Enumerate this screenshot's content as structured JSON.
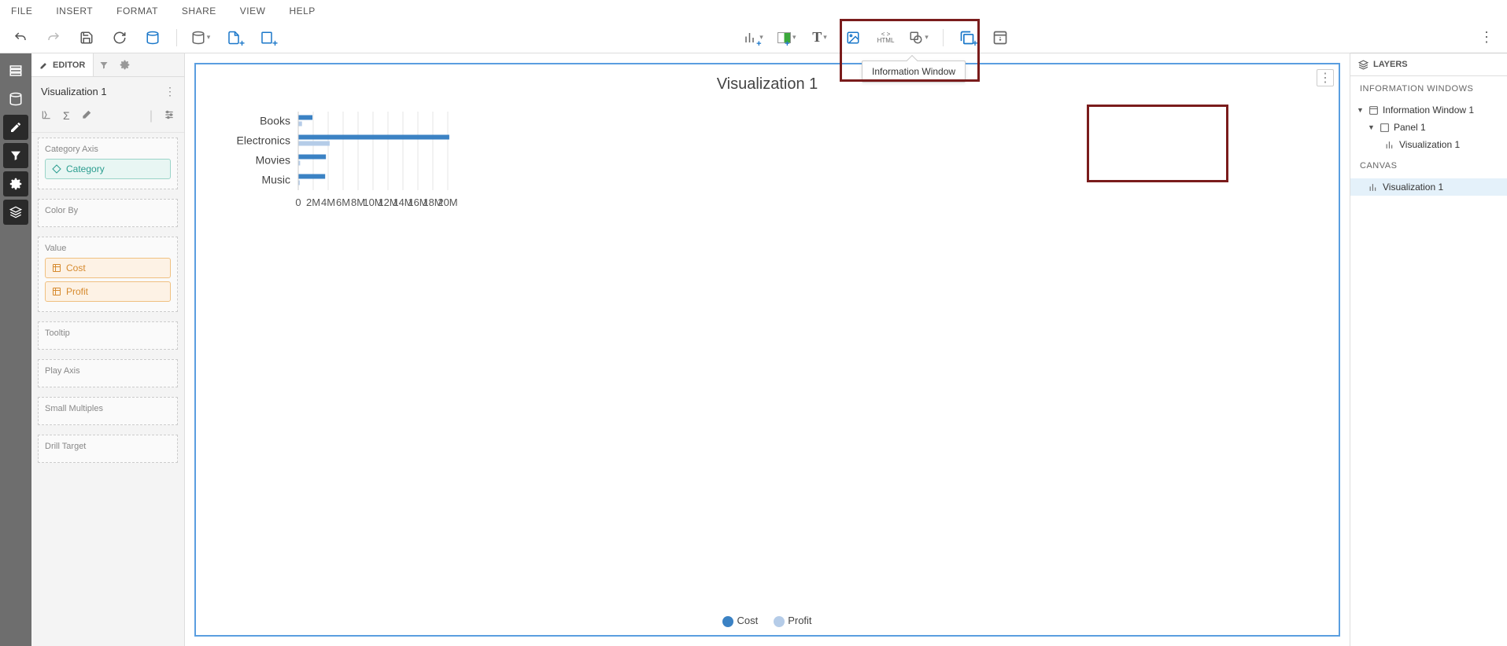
{
  "menu": {
    "items": [
      "FILE",
      "INSERT",
      "FORMAT",
      "SHARE",
      "VIEW",
      "HELP"
    ]
  },
  "tooltip": "Information Window",
  "editor": {
    "tab_label": "EDITOR",
    "viz_name": "Visualization 1",
    "sections": {
      "category_axis": "Category Axis",
      "color_by": "Color By",
      "value": "Value",
      "tooltip": "Tooltip",
      "play_axis": "Play Axis",
      "small_multiples": "Small Multiples",
      "drill_target": "Drill Target"
    },
    "pills": {
      "category": "Category",
      "cost": "Cost",
      "profit": "Profit"
    }
  },
  "chart_data": {
    "type": "bar",
    "orientation": "horizontal",
    "title": "Visualization 1",
    "categories": [
      "Books",
      "Electronics",
      "Movies",
      "Music"
    ],
    "series": [
      {
        "name": "Cost",
        "color": "#3b82c4",
        "values": [
          1900000,
          20200000,
          3700000,
          3600000
        ]
      },
      {
        "name": "Profit",
        "color": "#b5cce8",
        "values": [
          500000,
          4200000,
          250000,
          200000
        ]
      }
    ],
    "xlim": [
      0,
      20000000
    ],
    "xticks": [
      0,
      2000000,
      4000000,
      6000000,
      8000000,
      10000000,
      12000000,
      14000000,
      16000000,
      18000000,
      20000000
    ],
    "xtick_labels": [
      "0",
      "2M",
      "4M",
      "6M",
      "8M",
      "10M",
      "12M",
      "14M",
      "16M",
      "18M",
      "20M"
    ]
  },
  "layers": {
    "tab": "LAYERS",
    "section_info": "INFORMATION WINDOWS",
    "section_canvas": "CANVAS",
    "info_window": "Information Window 1",
    "panel": "Panel 1",
    "viz": "Visualization 1",
    "canvas_viz": "Visualization 1"
  },
  "colors": {
    "cost": "#3b82c4",
    "profit": "#b5cce8"
  }
}
